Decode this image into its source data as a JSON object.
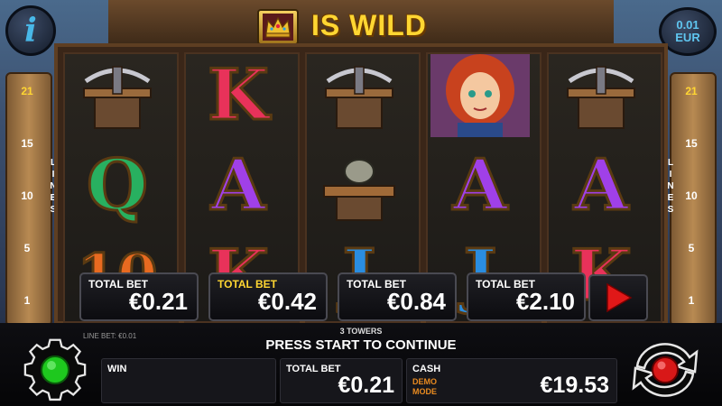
{
  "header": {
    "wild_text": "IS WILD",
    "info_label": "i",
    "denomination": "0.01",
    "currency": "EUR"
  },
  "lines": {
    "label": "LINES",
    "numbers": [
      "21",
      "15",
      "10",
      "5",
      "1"
    ],
    "active": "21"
  },
  "reels": [
    [
      "crossbow",
      "q",
      "10"
    ],
    [
      "k",
      "a",
      "k"
    ],
    [
      "crossbow",
      "catapult",
      "j"
    ],
    [
      "heroine",
      "a",
      "j"
    ],
    [
      "crossbow",
      "a",
      "k"
    ]
  ],
  "symbols": {
    "k": "K",
    "a": "A",
    "q": "Q",
    "j": "J",
    "10": "10"
  },
  "bets": [
    {
      "label": "TOTAL BET",
      "value": "€0.21",
      "selected": false
    },
    {
      "label": "TOTAL BET",
      "value": "€0.42",
      "selected": true
    },
    {
      "label": "TOTAL BET",
      "value": "€0.84",
      "selected": false
    },
    {
      "label": "TOTAL BET",
      "value": "€2.10",
      "selected": false
    }
  ],
  "status": {
    "line_bet": "LINE BET: €0.01",
    "game_name": "3 TOWERS",
    "message": "PRESS START TO CONTINUE"
  },
  "footer": {
    "win_label": "WIN",
    "win_value": "",
    "total_bet_label": "TOTAL BET",
    "total_bet_value": "€0.21",
    "cash_label": "CASH",
    "cash_value": "€19.53",
    "demo_line1": "DEMO",
    "demo_line2": "MODE"
  },
  "colors": {
    "accent_gold": "#ffd632",
    "info_blue": "#48b8e8",
    "play_red": "#e01818",
    "status_green": "#1ec81e"
  }
}
